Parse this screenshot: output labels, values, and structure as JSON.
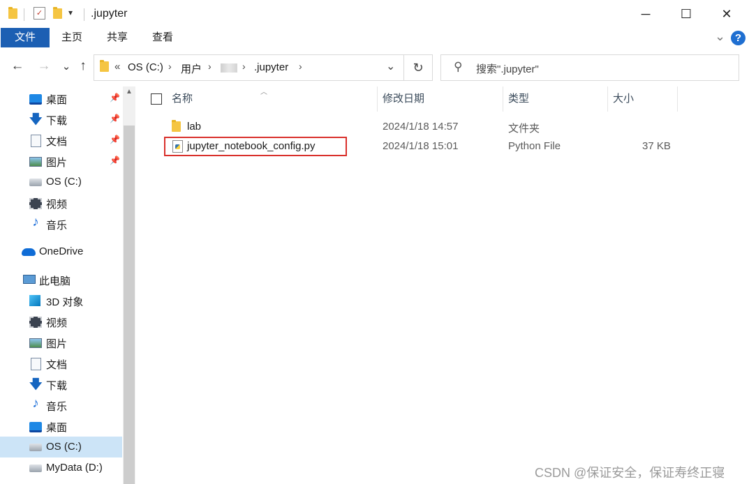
{
  "window": {
    "title": ".jupyter",
    "minimize_glyph": "─",
    "maximize_glyph": "☐",
    "close_glyph": "✕"
  },
  "quick_access": {
    "dropdown_glyph": "▾"
  },
  "ribbon": {
    "tabs": [
      "文件",
      "主页",
      "共享",
      "查看"
    ],
    "expand_glyph": "⌄",
    "help_glyph": "?"
  },
  "nav": {
    "back_glyph": "←",
    "forward_glyph": "→",
    "recent_glyph": "⌄",
    "up_glyph": "↑",
    "overflow_glyph": "«",
    "breadcrumbs": [
      "OS (C:)",
      "用户",
      ".jupyter"
    ],
    "crumb_separator": "›",
    "address_dropdown_glyph": "⌄",
    "refresh_glyph": "↻",
    "search_placeholder": "搜索\".jupyter\"",
    "search_glyph": "⚲"
  },
  "sidebar": {
    "items": [
      {
        "label": "桌面",
        "icon": "desktop-icon",
        "pinned": true
      },
      {
        "label": "下载",
        "icon": "download-icon",
        "pinned": true
      },
      {
        "label": "文档",
        "icon": "document-icon",
        "pinned": true
      },
      {
        "label": "图片",
        "icon": "pictures-icon",
        "pinned": true
      },
      {
        "label": "OS (C:)",
        "icon": "drive-icon",
        "pinned": false
      },
      {
        "label": "视频",
        "icon": "video-icon",
        "pinned": false
      },
      {
        "label": "音乐",
        "icon": "music-icon",
        "pinned": false
      },
      {
        "label": "OneDrive",
        "icon": "onedrive-icon",
        "pinned": false
      },
      {
        "label": "此电脑",
        "icon": "computer-icon",
        "pinned": false
      },
      {
        "label": "3D 对象",
        "icon": "3d-objects-icon",
        "pinned": false
      },
      {
        "label": "视频",
        "icon": "video-icon",
        "pinned": false
      },
      {
        "label": "图片",
        "icon": "pictures-icon",
        "pinned": false
      },
      {
        "label": "文档",
        "icon": "document-icon",
        "pinned": false
      },
      {
        "label": "下载",
        "icon": "download-icon",
        "pinned": false
      },
      {
        "label": "音乐",
        "icon": "music-icon",
        "pinned": false
      },
      {
        "label": "桌面",
        "icon": "desktop-icon",
        "pinned": false
      },
      {
        "label": "OS (C:)",
        "icon": "drive-icon",
        "pinned": false,
        "selected": true
      },
      {
        "label": "MyData (D:)",
        "icon": "drive-icon",
        "pinned": false
      }
    ],
    "pin_glyph": "📌",
    "download_glyph": "🡇",
    "music_glyph": "♪",
    "scroll_up_glyph": "▲"
  },
  "columns": {
    "name": "名称",
    "modified": "修改日期",
    "type": "类型",
    "size": "大小",
    "sort_glyph": "︿"
  },
  "files": [
    {
      "name": "lab",
      "modified": "2024/1/18 14:57",
      "type": "文件夹",
      "size": "",
      "icon": "folder-icon"
    },
    {
      "name": "jupyter_notebook_config.py",
      "modified": "2024/1/18 15:01",
      "type": "Python File",
      "size": "37 KB",
      "icon": "python-file-icon",
      "highlighted": true
    }
  ],
  "colors": {
    "file_tab": "#1c5fb3",
    "selection": "#cce4f7",
    "highlight_border": "#d9302b"
  },
  "watermark": "CSDN @保证安全，保证寿终正寝"
}
